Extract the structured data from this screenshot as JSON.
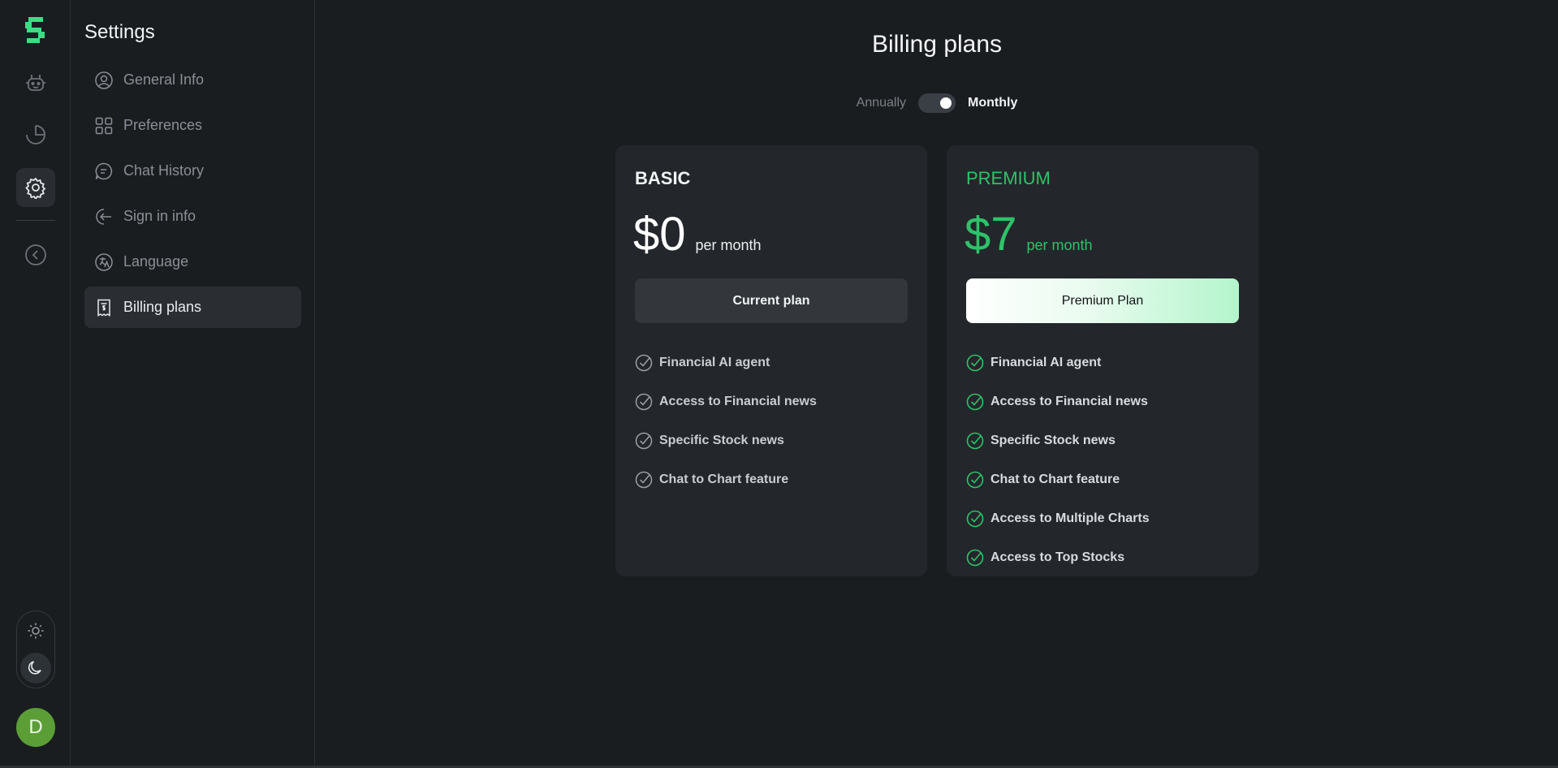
{
  "settings": {
    "title": "Settings",
    "nav": [
      {
        "label": "General Info",
        "icon": "user-circle-icon"
      },
      {
        "label": "Preferences",
        "icon": "grid-icon"
      },
      {
        "label": "Chat History",
        "icon": "chat-bubble-icon"
      },
      {
        "label": "Sign in info",
        "icon": "sign-in-icon"
      },
      {
        "label": "Language",
        "icon": "translate-icon"
      },
      {
        "label": "Billing plans",
        "icon": "receipt-icon",
        "active": true
      }
    ]
  },
  "rail": {
    "items": [
      "robot-icon",
      "pie-chart-icon",
      "gear-icon",
      "chevron-left-icon"
    ],
    "avatar_initial": "D"
  },
  "main": {
    "title": "Billing plans",
    "toggle": {
      "annual_label": "Annually",
      "monthly_label": "Monthly",
      "selected": "Monthly"
    }
  },
  "plans": {
    "basic": {
      "name": "BASIC",
      "price": "$0",
      "period": "per month",
      "button": "Current plan",
      "features": [
        "Financial AI agent",
        "Access to Financial news",
        "Specific Stock news",
        "Chat to Chart feature"
      ]
    },
    "premium": {
      "name": "PREMIUM",
      "price": "$7",
      "period": "per month",
      "button": "Premium Plan",
      "features": [
        "Financial AI agent",
        "Access to Financial news",
        "Specific Stock news",
        "Chat to Chart feature",
        "Access to Multiple Charts",
        "Access to Top Stocks"
      ]
    }
  },
  "colors": {
    "background": "#1a1d20",
    "card": "#23272b",
    "accent": "#2fc26a",
    "avatar": "#5b9e36"
  }
}
